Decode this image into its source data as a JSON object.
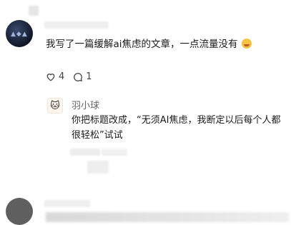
{
  "post": {
    "text": "我写了一篇缓解ai焦虑的文章，一点流量没有",
    "likes": "4",
    "comments": "1"
  },
  "reply": {
    "author": "羽小球",
    "text": "你把标题改成，“无须AI焦虑，我断定以后每个人都很轻松”试试"
  },
  "icons": {
    "like": "heart-outline-icon",
    "comment": "comment-bubble-icon",
    "emoji": "grinning-face-emoji-icon",
    "reply_avatar": "cat-avatar-icon"
  }
}
